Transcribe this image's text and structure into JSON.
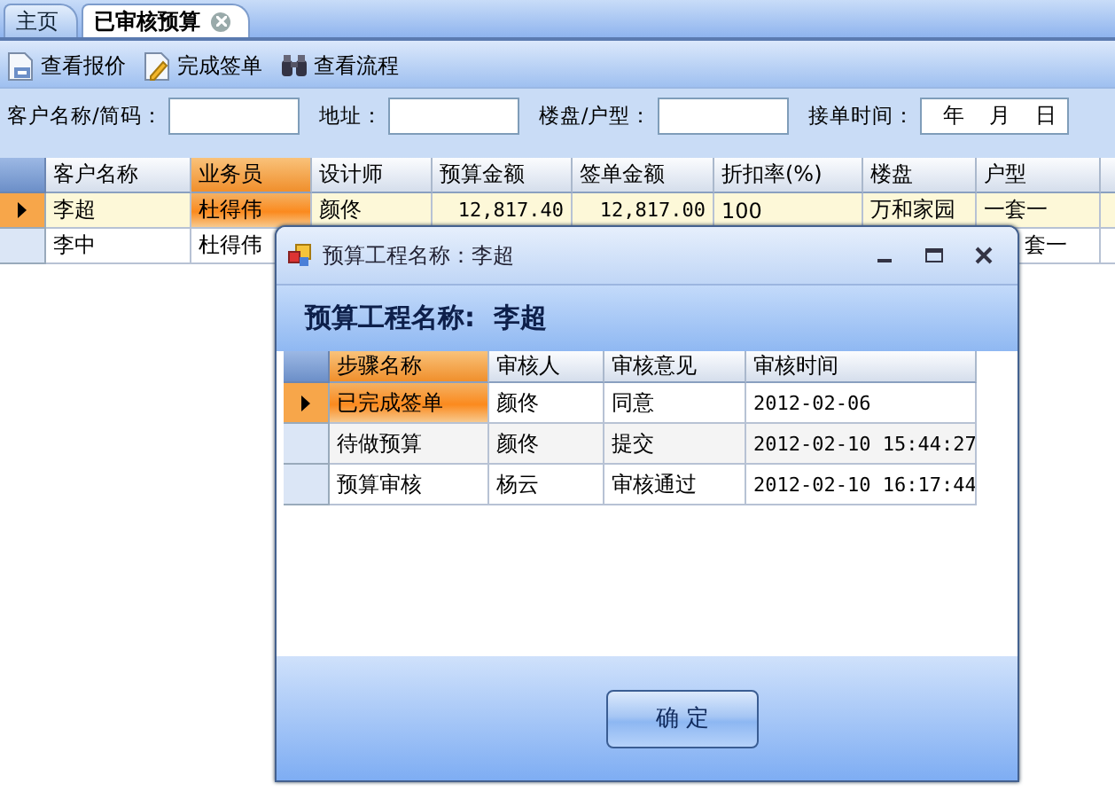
{
  "tabs": [
    {
      "label": "主页",
      "selected": false,
      "closable": false
    },
    {
      "label": "已审核预算",
      "selected": true,
      "closable": true
    }
  ],
  "toolbar": [
    {
      "label": "查看报价",
      "kind": "doc"
    },
    {
      "label": "完成签单",
      "kind": "sign"
    },
    {
      "label": "查看流程",
      "kind": "binoculars"
    }
  ],
  "filters": [
    {
      "label": "客户名称/简码：",
      "kind": "text"
    },
    {
      "label": "地址：",
      "kind": "text"
    },
    {
      "label": "楼盘/户型：",
      "kind": "text"
    },
    {
      "label": "接单时间：",
      "kind": "date",
      "year": "年",
      "month": "月",
      "day": "日"
    }
  ],
  "table": {
    "columns": [
      {
        "label": "客户名称",
        "selected": false
      },
      {
        "label": "业务员",
        "selected": true
      },
      {
        "label": "设计师",
        "selected": false
      },
      {
        "label": "预算金额",
        "selected": false
      },
      {
        "label": "签单金额",
        "selected": false
      },
      {
        "label": "折扣率(%)",
        "selected": false
      },
      {
        "label": "楼盘",
        "selected": false
      },
      {
        "label": "户型",
        "selected": false
      }
    ],
    "rows": [
      {
        "selected": true,
        "cells": [
          "李超",
          "杜得伟",
          "颜佟",
          "12,817.40",
          "12,817.00",
          "100",
          "万和家园",
          "一套一"
        ]
      },
      {
        "selected": false,
        "cells": [
          "李中",
          "杜得伟",
          null,
          null,
          null,
          null,
          null,
          "套一"
        ]
      }
    ]
  },
  "dialog": {
    "title": "预算工程名称：李超",
    "heading": "预算工程名称:  李超",
    "columns": [
      {
        "label": "步骤名称",
        "selected": true
      },
      {
        "label": "审核人",
        "selected": false
      },
      {
        "label": "审核意见",
        "selected": false
      },
      {
        "label": "审核时间",
        "selected": false
      }
    ],
    "rows": [
      {
        "selected": true,
        "cells": [
          "已完成签单",
          "颜佟",
          "同意",
          "2012-02-06"
        ]
      },
      {
        "selected": false,
        "cells": [
          "待做预算",
          "颜佟",
          "提交",
          "2012-02-10 15:44:27"
        ]
      },
      {
        "selected": false,
        "cells": [
          "预算审核",
          "杨云",
          "审核通过",
          "2012-02-10 16:17:44"
        ]
      }
    ],
    "ok_button": "确 定"
  }
}
